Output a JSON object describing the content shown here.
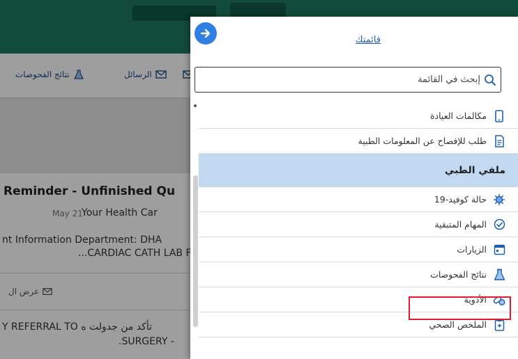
{
  "background": {
    "toolbar": {
      "messages_label": "الرسائل",
      "test_results_label": "نتائج الفحوصات"
    },
    "message": {
      "title": "Reminder - Unfinished Qu",
      "date": "May 21",
      "from": "Your Health Car",
      "preview_line1": "nt Information Department: DHA",
      "preview_line2": "...CARDIAC CATH LAB F",
      "view_label": "عرض ال",
      "body_line1": "Y REFERRAL TO تأكد من جدولت ه",
      "body_line2": ".SURGERY -"
    }
  },
  "panel": {
    "title": "قائمتك",
    "search": {
      "value": "إبحث في القائمة",
      "placeholder": "إبحث في القائمة"
    },
    "items": [
      {
        "label": "مكالمات العيادة",
        "icon": "phone-icon"
      },
      {
        "label": "طلب للإفصاح عن المعلومات الطبية",
        "icon": "document-icon"
      }
    ],
    "section_title": "ملفي الطبي",
    "section_items": [
      {
        "label": "حالة كوفيد-19",
        "icon": "virus-icon"
      },
      {
        "label": "المهام المتبقية",
        "icon": "check-circle-icon"
      },
      {
        "label": "الزيارات",
        "icon": "calendar-icon"
      },
      {
        "label": "نتائج الفحوصات",
        "icon": "flask-icon"
      },
      {
        "label": "الأدوية",
        "icon": "pills-icon"
      },
      {
        "label": "الملخص الصحي",
        "icon": "clipboard-icon"
      }
    ]
  },
  "colors": {
    "accent": "#2f80e0",
    "header_green": "#1d7a5e",
    "section_bg": "#c3d9f2",
    "highlight": "#e01b2b"
  }
}
